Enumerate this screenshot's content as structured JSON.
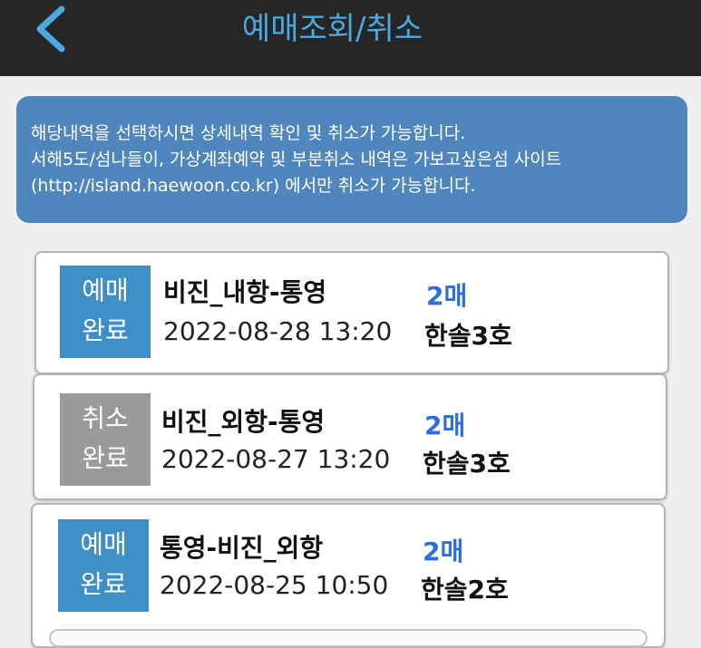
{
  "header": {
    "title": "예매조회/취소",
    "back_icon": "chevron-left-icon",
    "title_color": "#4aa9e0",
    "background": "#262626"
  },
  "notice": {
    "line1": "해당내역을 선택하시면 상세내역 확인 및 취소가 가능합니다.",
    "line2": "서해5도/섬나들이, 가상계좌예약 및 부분취소 내역은 가보고싶은섬 사이트",
    "line3": "(http://island.haewoon.co.kr) 에서만 취소가 가능합니다.",
    "background": "#4e86bd"
  },
  "reservations": [
    {
      "status_line1": "예매",
      "status_line2": "완료",
      "status_color": "#3e8fc8",
      "route": "비진_내항-통영",
      "count": "2매",
      "datetime": "2022-08-28 13:20",
      "ship": "한솔3호"
    },
    {
      "status_line1": "취소",
      "status_line2": "완료",
      "status_color": "#9a9a9a",
      "route": "비진_외항-통영",
      "count": "2매",
      "datetime": "2022-08-27 13:20",
      "ship": "한솔3호"
    },
    {
      "status_line1": "예매",
      "status_line2": "완료",
      "status_color": "#3e8fc8",
      "route": "통영-비진_외항",
      "count": "2매",
      "datetime": "2022-08-25 10:50",
      "ship": "한솔2호"
    }
  ]
}
